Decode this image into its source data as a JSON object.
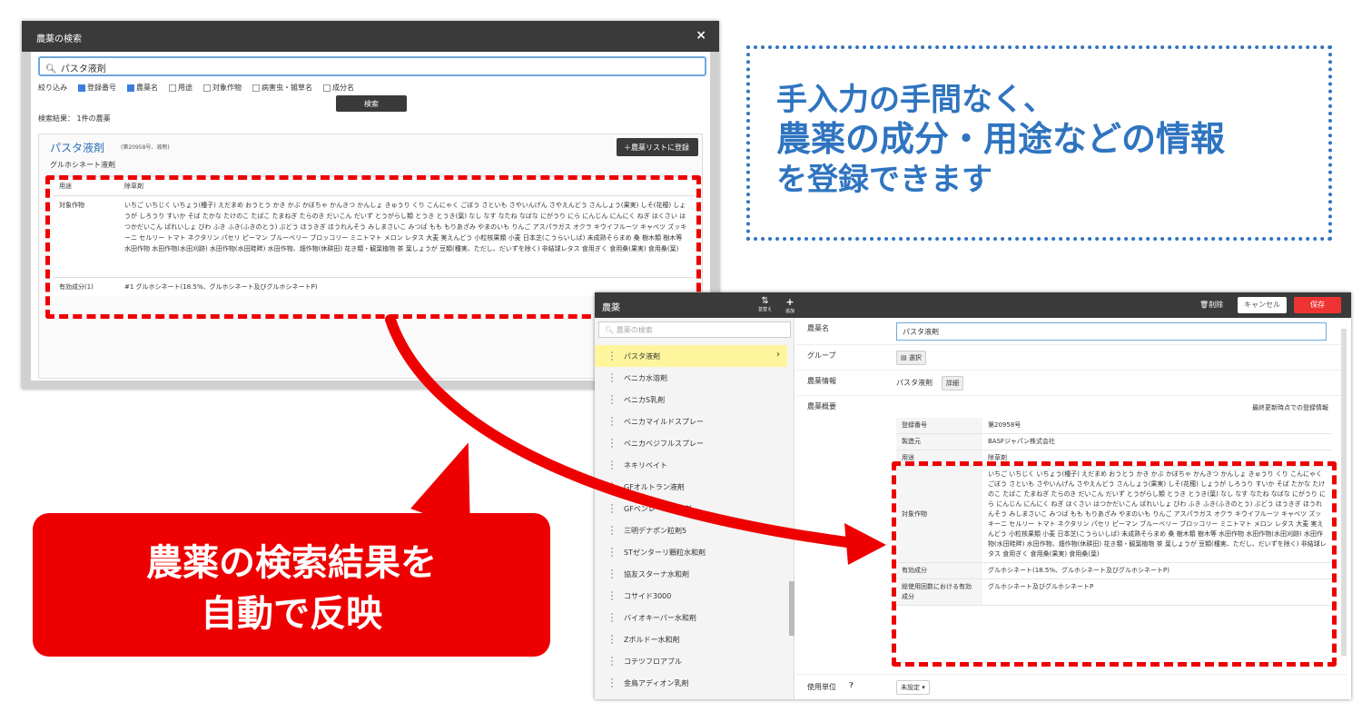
{
  "modal": {
    "title": "農薬の検索",
    "close": "×",
    "search_value": "パスタ液剤",
    "filter_label": "絞り込み",
    "filters": [
      {
        "label": "登録番号",
        "checked": true
      },
      {
        "label": "農薬名",
        "checked": true
      },
      {
        "label": "用途",
        "checked": false
      },
      {
        "label": "対象作物",
        "checked": false
      },
      {
        "label": "病害虫・雑草名",
        "checked": false
      },
      {
        "label": "成分名",
        "checked": false
      }
    ],
    "search_button": "検索",
    "result_count": "検索結果： 1件の農薬",
    "result": {
      "name": "パスタ液剤",
      "sub": "(第20958号、液剤)",
      "add_button": "＋農薬リストに登録",
      "ingredient": "グルホシネート液剤",
      "rows": [
        {
          "k": "用途",
          "v": "除草剤"
        },
        {
          "k": "対象作物",
          "v": "いちご いちじく いちょう(種子) えだまめ おうとう かき かぶ かぼちゃ かんきつ かんしょ きゅうり くり こんにゃく ごぼう さといも さやいんげん さやえんどう さんしょう(果実) しそ(花穂) しょうが しろうり すいか そば たかな たけのこ たばこ たまねぎ たらのき だいこん だいず とうがらし類 とうき とうき(葉) なし なす なたね なばな にがうり にら にんじん にんにく ねぎ はくさい はつかだいこん ばれいしょ びわ ふき ふき(ふきのとう) ぶどう ほうきぎ ほうれんそう みしまさいこ みつば もも もりあざみ やまのいも りんご アスパラガス オクラ キウイフルーツ キャベツ ズッキーニ セルリー トマト ネクタリン パセリ ピーマン ブルーベリー ブロッコリー ミニトマト メロン レタス 大麦 実えんどう 小粒核果類 小麦 日本芝(こうらいしば) 未成熟そらまめ 桑 樹木類 樹木等 水田作物 水田作物(水田刈跡) 水田作物(水田畦畔) 水田作物、畑作物(休耕田) 花き類・観葉植物 茶 葉しょうが 豆類(種実、ただし、だいずを除く) 非結球レタス 食用ぎく 食用桑(果実) 食用桑(葉)"
        },
        {
          "k": "有効成分(1)",
          "v": "#1 グルホシネート(18.5%、グルホシネート及びグルホシネートP)"
        }
      ]
    }
  },
  "callout_blue": [
    "手入力の手間なく、",
    "農薬の成分・用途などの情報",
    "を登録できます"
  ],
  "callout_red": [
    "農薬の検索結果を",
    "自動で反映"
  ],
  "reg": {
    "title": "農薬",
    "header_buttons": [
      {
        "label": "並替え"
      },
      {
        "label": "追加"
      }
    ],
    "delete": "削除",
    "cancel": "キャンセル",
    "save": "保存",
    "side_search_placeholder": "農薬の検索",
    "side_items": [
      "パスタ液剤",
      "ベニカ水溶剤",
      "ベニカS乳剤",
      "ベニカマイルドスプレー",
      "ベニカベジフルスプレー",
      "ネキリベイト",
      "GFオルトラン液剤",
      "GFベンレート水和剤",
      "三明デナポン粒剤5",
      "STゼンターリ顆粒水和剤",
      "協友スターナ水和剤",
      "コサイド3000",
      "バイオキーパー水和剤",
      "Zボルドー水和剤",
      "コテツフロアブル",
      "金鳥アディオン乳剤"
    ],
    "fields": {
      "name_label": "農薬名",
      "name_value": "パスタ液剤",
      "group_label": "グループ",
      "group_button": "選択",
      "info_label": "農薬情報",
      "info_value": "パスタ液剤",
      "info_button": "詳細",
      "summary_label": "農薬概要",
      "summary_note": "最終更新時点での登録情報",
      "unit_label": "使用単位",
      "unit_value": "未設定"
    },
    "overview": [
      {
        "k": "登録番号",
        "v": "第20958号"
      },
      {
        "k": "製造元",
        "v": "BASFジャパン株式会社"
      },
      {
        "k": "用途",
        "v": "除草剤"
      },
      {
        "k": "対象作物",
        "v": "いちご いちじく いちょう(種子) えだまめ おうとう かき かぶ かぼちゃ かんきつ かんしょ きゅうり くり こんにゃく ごぼう さといも さやいんげん さやえんどう さんしょう(果実) しそ(花穂) しょうが しろうり すいか そば たかな たけのこ たばこ たまねぎ たらのき だいこん だいず とうがらし類 とうき とうき(葉) なし なす なたね なばな にがうり にら にんじん にんにく ねぎ はくさい はつかだいこん ばれいしょ びわ ふき ふき(ふきのとう) ぶどう ほうきぎ ほうれんそう みしまさいこ みつば もも もりあざみ やまのいも りんご アスパラガス オクラ キウイフルーツ キャベツ ズッキーニ セルリー トマト ネクタリン パセリ ピーマン ブルーベリー ブロッコリー ミニトマト メロン レタス 大麦 実えんどう 小粒核果類 小麦 日本芝(こうらいしば) 未成熟そらまめ 桑 樹木類 樹木等 水田作物 水田作物(水田刈跡) 水田作物(水田畦畔) 水田作物、畑作物(休耕田) 花き類・観葉植物 茶 葉しょうが 豆類(種実、ただし、だいずを除く) 非結球レタス 食用ぎく 食用桑(果実) 食用桑(葉)"
      },
      {
        "k": "有効成分",
        "v": "グルホシネート(18.5%、グルホシネート及びグルホシネートP)"
      },
      {
        "k": "総使用回数における有効成分",
        "v": "グルホシネート及びグルホシネートP"
      }
    ]
  },
  "colors": {
    "red": "#e00000",
    "blue": "#2f74c0",
    "header": "#3a3a3a",
    "selected": "#fff59d"
  }
}
